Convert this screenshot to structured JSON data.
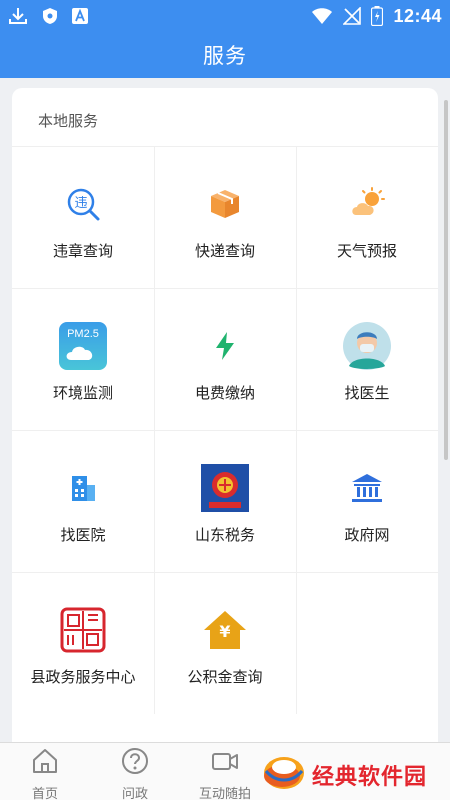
{
  "status_bar": {
    "time": "12:44",
    "icons": [
      "download-icon",
      "shield-icon",
      "a-icon",
      "wifi-icon",
      "no-signal-icon",
      "battery-icon"
    ]
  },
  "app_bar": {
    "title": "服务"
  },
  "local_services": {
    "title": "本地服务",
    "items": [
      {
        "label": "违章查询",
        "icon": "violation-search-icon"
      },
      {
        "label": "快递查询",
        "icon": "package-icon"
      },
      {
        "label": "天气预报",
        "icon": "weather-icon"
      },
      {
        "label": "环境监测",
        "icon": "pm25-icon",
        "icon_text": "PM2.5"
      },
      {
        "label": "电费缴纳",
        "icon": "lightning-icon"
      },
      {
        "label": "找医生",
        "icon": "doctor-avatar-icon"
      },
      {
        "label": "找医院",
        "icon": "hospital-icon"
      },
      {
        "label": "山东税务",
        "icon": "tax-emblem-icon"
      },
      {
        "label": "政府网",
        "icon": "government-building-icon"
      },
      {
        "label": "县政务服务中心",
        "icon": "seal-icon"
      },
      {
        "label": "公积金查询",
        "icon": "housing-fund-icon",
        "icon_text": "¥"
      }
    ]
  },
  "tab_bar": {
    "tabs": [
      {
        "label": "首页",
        "icon": "home-icon"
      },
      {
        "label": "问政",
        "icon": "question-icon"
      },
      {
        "label": "互动随拍",
        "icon": "video-camera-icon"
      }
    ]
  },
  "watermark": {
    "text": "经典软件园"
  },
  "colors": {
    "primary": "#3d8ef0",
    "background": "#eef0f3",
    "watermark_red": "#e3262e"
  }
}
